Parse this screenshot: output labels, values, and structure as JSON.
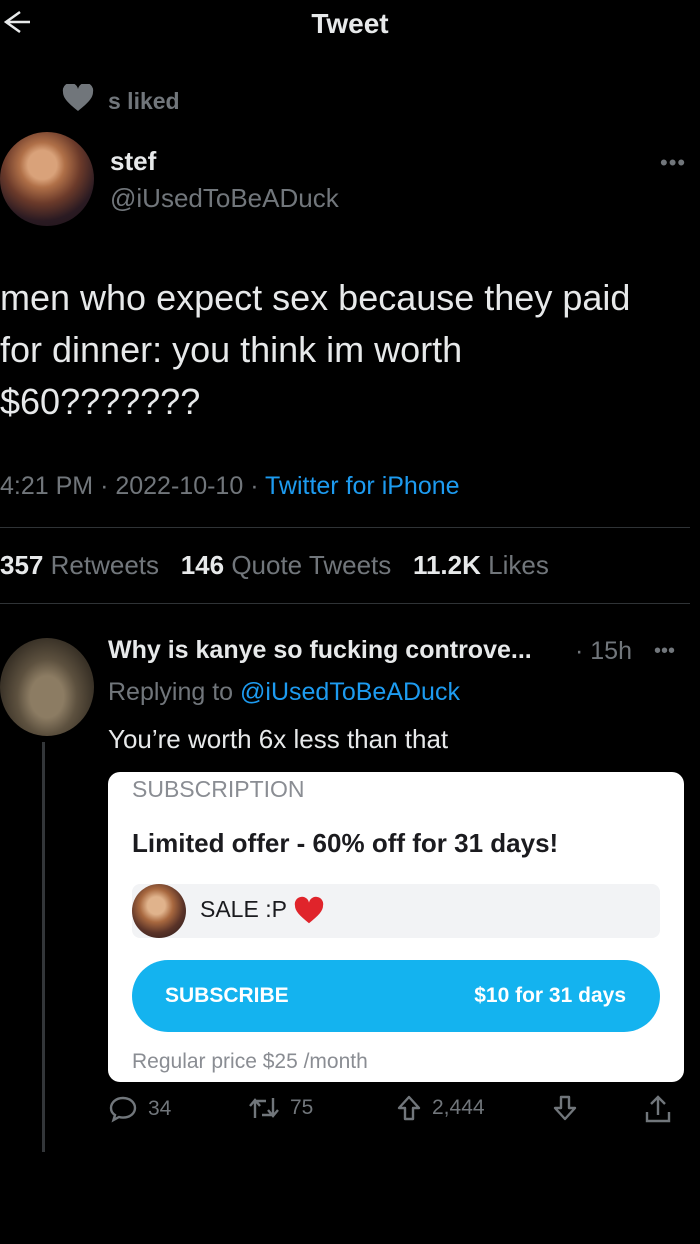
{
  "header": {
    "title": "Tweet"
  },
  "social_context": {
    "text": "s liked"
  },
  "tweet": {
    "author_name": "stef",
    "author_handle": "@iUsedToBeADuck",
    "text_lines": [
      "men who expect sex because they paid",
      "for dinner: you think im worth",
      "$60???????"
    ],
    "time": "4:21 PM",
    "date": "2022-10-10",
    "source": "Twitter for iPhone",
    "sep": "·",
    "retweets_count": "357",
    "retweets_label": "Retweets",
    "quotes_count": "146",
    "quotes_label": "Quote Tweets",
    "likes_count": "11.2K",
    "likes_label": "Likes"
  },
  "reply": {
    "author_name": "Why is kanye so fucking controve...",
    "time": "· 15h",
    "replying_label": "Replying to",
    "replying_handle": "@iUsedToBeADuck",
    "text": "You’re worth 6x less than that",
    "card": {
      "label": "SUBSCRIPTION",
      "offer": "Limited offer - 60% off for 31 days!",
      "sale_text": "SALE :P",
      "subscribe_label": "SUBSCRIBE",
      "price_label": "$10 for 31 days",
      "regular_price": "Regular price $25 /month"
    },
    "actions": {
      "replies": "34",
      "retweets": "75",
      "upvotes": "2,444"
    }
  },
  "icons": [
    "back-arrow-icon",
    "heart-icon",
    "more-icon",
    "reply-icon",
    "retweet-icon",
    "upvote-icon",
    "downvote-icon",
    "share-icon"
  ],
  "colors": {
    "background": "#000000",
    "accent": "#1d9bf0",
    "muted": "#71767b",
    "subscribe": "#14b3ef"
  }
}
